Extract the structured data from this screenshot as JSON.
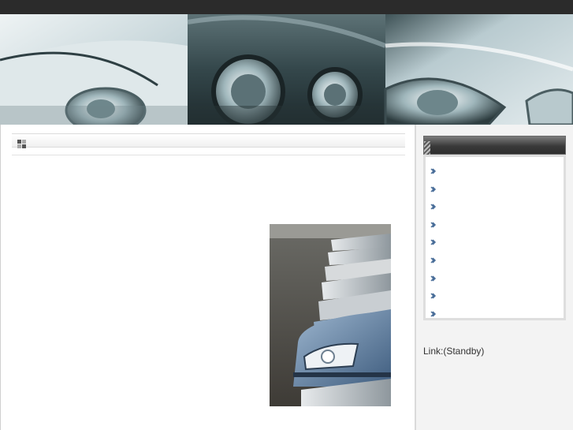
{
  "header": {
    "banner_images": [
      "white-car-headlight-photo",
      "dark-car-twin-headlights-photo",
      "silver-car-headlight-photo"
    ]
  },
  "main": {
    "title_icon": "grid-squares-icon",
    "title": "",
    "photo": "parked-cars-row-photo"
  },
  "sidebar": {
    "panel_title": "",
    "menu_items": [
      {
        "label": "",
        "icon": "chevron-right-icon"
      },
      {
        "label": "",
        "icon": "chevron-right-icon"
      },
      {
        "label": "",
        "icon": "chevron-right-icon"
      },
      {
        "label": "",
        "icon": "chevron-right-icon"
      },
      {
        "label": "",
        "icon": "chevron-right-icon"
      },
      {
        "label": "",
        "icon": "chevron-right-icon"
      },
      {
        "label": "",
        "icon": "chevron-right-icon"
      },
      {
        "label": "",
        "icon": "chevron-right-icon"
      },
      {
        "label": "",
        "icon": "chevron-right-icon"
      }
    ],
    "link_text": "Link:(Standby)"
  },
  "colors": {
    "topbar": "#2b2b2b",
    "panel_header": "#3a3a3a",
    "sidebar_bg": "#f3f3f3",
    "arrow": "#4a6e99"
  }
}
